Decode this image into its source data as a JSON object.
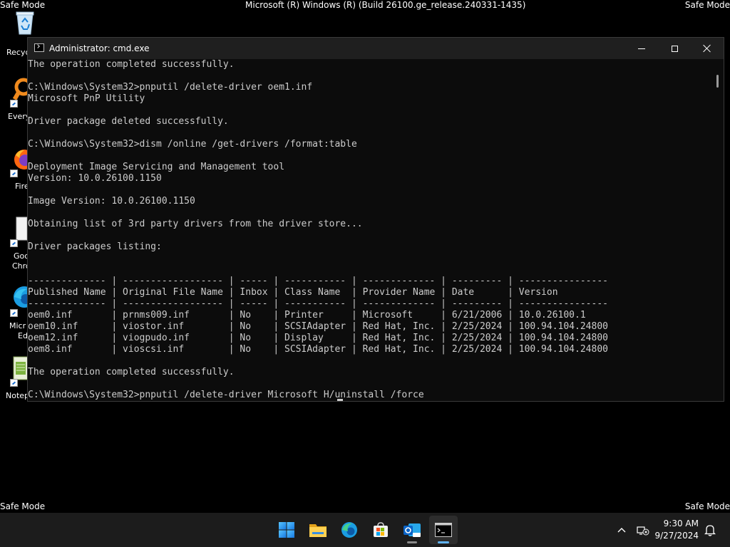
{
  "desktop": {
    "safe_mode_label": "Safe Mode",
    "build_text": "Microsoft (R) Windows (R) (Build 26100.ge_release.240331-1435)",
    "icons": [
      {
        "label": "Recyc",
        "icon": "recycle-bin-icon"
      },
      {
        "label": "Every",
        "icon": "everything-icon"
      },
      {
        "label": "Fire",
        "icon": "firefox-icon"
      },
      {
        "label": "Goo",
        "label2": "Chro",
        "icon": "chrome-icon"
      },
      {
        "label": "Micr",
        "label2": "Ed",
        "icon": "edge-icon"
      },
      {
        "label": "Notep",
        "icon": "notepad-icon"
      }
    ]
  },
  "window": {
    "title": "Administrator: cmd.exe",
    "icon": "cmd-icon",
    "controls": {
      "minimize": "minimize-icon",
      "maximize": "maximize-icon",
      "close": "close-icon"
    }
  },
  "console": {
    "lines": [
      "The operation completed successfully.",
      "",
      "C:\\Windows\\System32>pnputil /delete-driver oem1.inf",
      "Microsoft PnP Utility",
      "",
      "Driver package deleted successfully.",
      "",
      "C:\\Windows\\System32>dism /online /get-drivers /format:table",
      "",
      "Deployment Image Servicing and Management tool",
      "Version: 10.0.26100.1150",
      "",
      "Image Version: 10.0.26100.1150",
      "",
      "Obtaining list of 3rd party drivers from the driver store...",
      "",
      "Driver packages listing:",
      "",
      "",
      "-------------- | ------------------ | ----- | ----------- | ------------- | --------- | ----------------",
      "Published Name | Original File Name | Inbox | Class Name  | Provider Name | Date      | Version",
      "-------------- | ------------------ | ----- | ----------- | ------------- | --------- | ----------------",
      "oem0.inf       | prnms009.inf       | No    | Printer     | Microsoft     | 6/21/2006 | 10.0.26100.1",
      "oem10.inf      | viostor.inf        | No    | SCSIAdapter | Red Hat, Inc. | 2/25/2024 | 100.94.104.24800",
      "oem12.inf      | viogpudo.inf       | No    | Display     | Red Hat, Inc. | 2/25/2024 | 100.94.104.24800",
      "oem8.inf       | vioscsi.inf        | No    | SCSIAdapter | Red Hat, Inc. | 2/25/2024 | 100.94.104.24800",
      "",
      "The operation completed successfully.",
      "",
      "C:\\Windows\\System32>pnputil /delete-driver Microsoft H/uninstall /force"
    ]
  },
  "taskbar": {
    "items": [
      {
        "name": "start-button",
        "icon": "windows-logo-icon"
      },
      {
        "name": "file-explorer-button",
        "icon": "folder-icon"
      },
      {
        "name": "edge-button",
        "icon": "edge-icon"
      },
      {
        "name": "store-button",
        "icon": "store-icon"
      },
      {
        "name": "outlook-button",
        "icon": "outlook-icon"
      },
      {
        "name": "cmd-button",
        "icon": "terminal-icon",
        "active": true
      }
    ],
    "tray": {
      "chevron": "chevron-up-icon",
      "network": "network-disconnected-icon",
      "notifications": "bell-icon"
    },
    "time": "9:30 AM",
    "date": "9/27/2024"
  },
  "colors": {
    "console_text": "#cccccc",
    "console_bg": "#0c0c0c",
    "titlebar_bg": "#1f1f1f",
    "taskbar_bg": "#1c1c1c",
    "accent": "#5fb2f2"
  }
}
